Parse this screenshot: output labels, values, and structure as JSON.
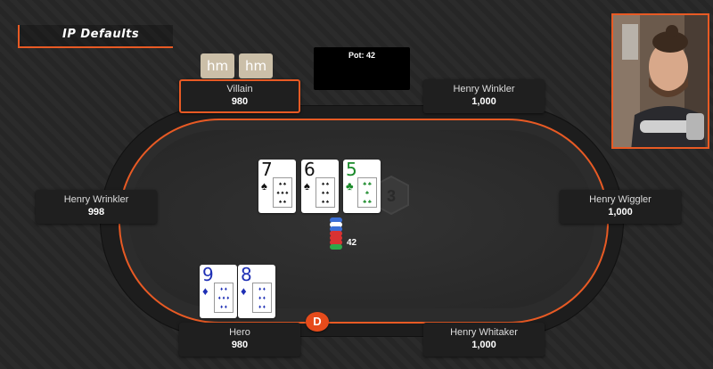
{
  "title_tag": "IP Defaults",
  "pot_label": "Pot: 42",
  "pot_amount": "42",
  "hidden_card_text": "hm",
  "seats": [
    {
      "name": "Villain",
      "stack": "980"
    },
    {
      "name": "Henry Winkler",
      "stack": "1,000"
    },
    {
      "name": "Henry Wrinkler",
      "stack": "998"
    },
    {
      "name": "Henry Wiggler",
      "stack": "1,000"
    },
    {
      "name": "Hero",
      "stack": "980"
    },
    {
      "name": "Henry Whitaker",
      "stack": "1,000"
    }
  ],
  "board_cards": [
    {
      "rank": "7",
      "suit": "♠",
      "color": "#111111"
    },
    {
      "rank": "6",
      "suit": "♠",
      "color": "#111111"
    },
    {
      "rank": "5",
      "suit": "♣",
      "color": "#1a8a2a"
    }
  ],
  "hero_cards": [
    {
      "rank": "9",
      "suit": "♦",
      "color": "#1e2fb5"
    },
    {
      "rank": "8",
      "suit": "♦",
      "color": "#1e2fb5"
    }
  ],
  "dealer_button": "D",
  "hex_logo_text": "3",
  "accent_color": "#e85a24",
  "icons": {
    "dealer": "dealer-button-icon",
    "chips": "chip-stack-icon",
    "logo": "hexagon-logo-icon"
  }
}
